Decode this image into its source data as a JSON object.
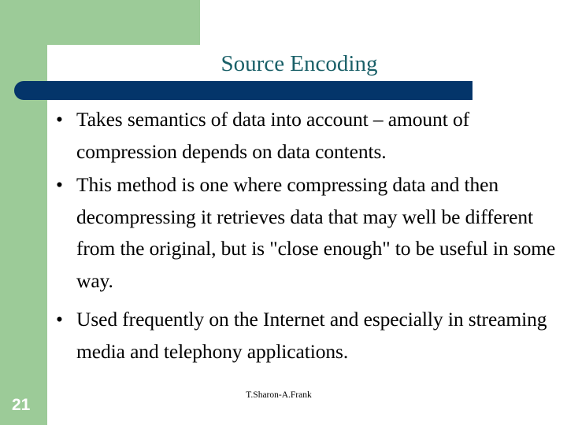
{
  "slide": {
    "title": "Source Encoding",
    "bullets": [
      {
        "text": "Takes semantics of data into account – amount of compression depends on data contents.",
        "marker": "•"
      },
      {
        "text": "This method is one where compressing data and then decompressing it retrieves data that may well be different from the original, but is \"close enough\" to be useful in some way.",
        "marker": "•"
      },
      {
        "text": "Used frequently on the Internet and especially in streaming media and telephony applications.",
        "marker": "•"
      }
    ],
    "page_number": "21",
    "attribution": "T.Sharon-A.Frank",
    "colors": {
      "green_band": "#9ccb98",
      "navy_bar": "#04356a",
      "title_teal": "#1a6068",
      "body_text": "#000000",
      "page_number_text": "#ffffff",
      "background": "#ffffff"
    }
  }
}
